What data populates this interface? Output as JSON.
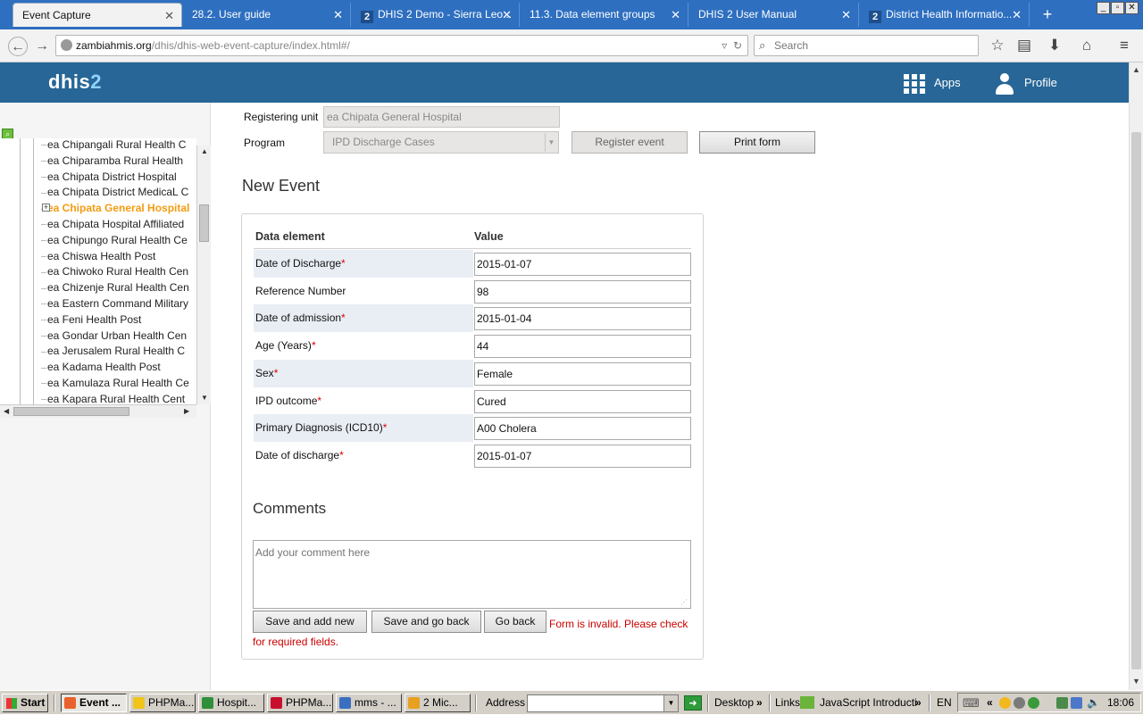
{
  "browser": {
    "tabs": [
      {
        "label": "Event Capture",
        "active": true
      },
      {
        "label": "28.2. User guide",
        "active": false
      },
      {
        "label": "DHIS 2 Demo - Sierra Leo...",
        "active": false
      },
      {
        "label": "11.3. Data element groups",
        "active": false
      },
      {
        "label": "DHIS 2 User Manual",
        "active": false
      },
      {
        "label": "District Health Informatio...",
        "active": false
      }
    ],
    "url_host": "zambiahmis.org",
    "url_path": "/dhis/dhis-web-event-capture/index.html#/",
    "search_placeholder": "Search"
  },
  "header": {
    "logo_text": "dhis",
    "logo_number": "2",
    "apps_label": "Apps",
    "profile_label": "Profile"
  },
  "tree": {
    "items": [
      {
        "label": "ea Chipangali Rural Health C",
        "selected": false
      },
      {
        "label": "ea Chiparamba Rural Health",
        "selected": false
      },
      {
        "label": "ea Chipata District Hospital",
        "selected": false
      },
      {
        "label": "ea Chipata District MedicaL C",
        "selected": false
      },
      {
        "label": "ea Chipata General Hospital",
        "selected": true
      },
      {
        "label": "ea Chipata Hospital Affiliated",
        "selected": false
      },
      {
        "label": "ea Chipungo Rural Health Ce",
        "selected": false
      },
      {
        "label": "ea Chiswa Health Post",
        "selected": false
      },
      {
        "label": "ea Chiwoko Rural Health Cen",
        "selected": false
      },
      {
        "label": "ea Chizenje Rural Health Cen",
        "selected": false
      },
      {
        "label": "ea Eastern Command Military",
        "selected": false
      },
      {
        "label": "ea Feni Health Post",
        "selected": false
      },
      {
        "label": "ea Gondar Urban Health Cen",
        "selected": false
      },
      {
        "label": "ea Jerusalem Rural Health C",
        "selected": false
      },
      {
        "label": "ea Kadama Health Post",
        "selected": false
      },
      {
        "label": "ea Kamulaza Rural Health Ce",
        "selected": false
      },
      {
        "label": "ea Kapara Rural Health Cent",
        "selected": false
      }
    ]
  },
  "form": {
    "registering_unit_label": "Registering unit",
    "registering_unit_value": "ea Chipata General Hospital",
    "program_label": "Program",
    "program_value": "IPD Discharge Cases",
    "register_event_label": "Register event",
    "print_form_label": "Print form",
    "new_event_title": "New Event",
    "col_data_element": "Data element",
    "col_value": "Value",
    "rows": [
      {
        "label": "Date of Discharge",
        "required": true,
        "value": "2015-01-07"
      },
      {
        "label": "Reference Number",
        "required": false,
        "value": "98"
      },
      {
        "label": "Date of admission",
        "required": true,
        "value": "2015-01-04"
      },
      {
        "label": "Age (Years)",
        "required": true,
        "value": "44"
      },
      {
        "label": "Sex",
        "required": true,
        "value": "Female"
      },
      {
        "label": "IPD outcome",
        "required": true,
        "value": "Cured"
      },
      {
        "label": "Primary Diagnosis (ICD10)",
        "required": true,
        "value": "A00 Cholera"
      },
      {
        "label": "Date of discharge",
        "required": true,
        "value": "2015-01-07"
      }
    ],
    "required_marker": "*",
    "comments_title": "Comments",
    "comment_placeholder": "Add your comment here",
    "save_add_new_label": "Save and add new",
    "save_go_back_label": "Save and go back",
    "go_back_label": "Go back",
    "error_message": "Form is invalid. Please check for required fields."
  },
  "taskbar": {
    "start_label": "Start",
    "buttons": [
      {
        "label": "Event ...",
        "active": true,
        "color": "#e8612c"
      },
      {
        "label": "PHPMa...",
        "active": false,
        "color": "#f0c419"
      },
      {
        "label": "Hospit...",
        "active": false,
        "color": "#2f8f3a"
      },
      {
        "label": "PHPMa...",
        "active": false,
        "color": "#c8102e"
      },
      {
        "label": "mms - ...",
        "active": false,
        "color": "#3a6fc0"
      },
      {
        "label": "2 Mic...",
        "active": false,
        "color": "#e8a020"
      }
    ],
    "address_label": "Address",
    "desktop_label": "Desktop",
    "links_label": "Links",
    "js_link_label": "JavaScript Introducti",
    "lang": "EN",
    "clock": "18:06"
  },
  "colors": {
    "dhis_header": "#276696",
    "selected_tree_item": "#f39c12",
    "error": "#cc0000"
  }
}
